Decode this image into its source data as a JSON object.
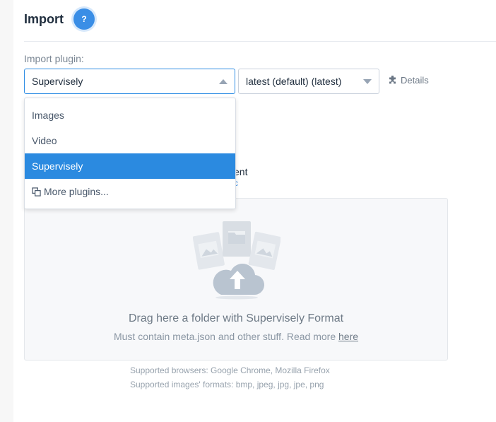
{
  "header": {
    "title": "Import",
    "help_badge": "?"
  },
  "form": {
    "plugin_label": "Import plugin:",
    "plugin_selected": "Supervisely",
    "version_selected": "latest (default) (latest)",
    "details_label": "Details"
  },
  "dropdown": {
    "options": [
      {
        "label": "Images"
      },
      {
        "label": "Video"
      },
      {
        "label": "Supervisely",
        "selected": true
      },
      {
        "label": "More plugins...",
        "icon": "copy-icon"
      }
    ]
  },
  "hidden_behind_dropdown": {
    "text_fragment": "ent",
    "link_fragment": "c"
  },
  "dropzone": {
    "title": "Drag here a folder with Supervisely Format",
    "subtitle": "Must contain meta.json and other stuff. Read more",
    "link_label": "here",
    "icon": "cloud-upload-icon"
  },
  "support": {
    "browsers": "Supported browsers: Google Chrome, Mozilla Firefox",
    "formats": "Supported images' formats: bmp, jpeg, jpg, jpe, png"
  },
  "colors": {
    "accent": "#2b8ae0",
    "help_badge": "#3a8ee6"
  }
}
